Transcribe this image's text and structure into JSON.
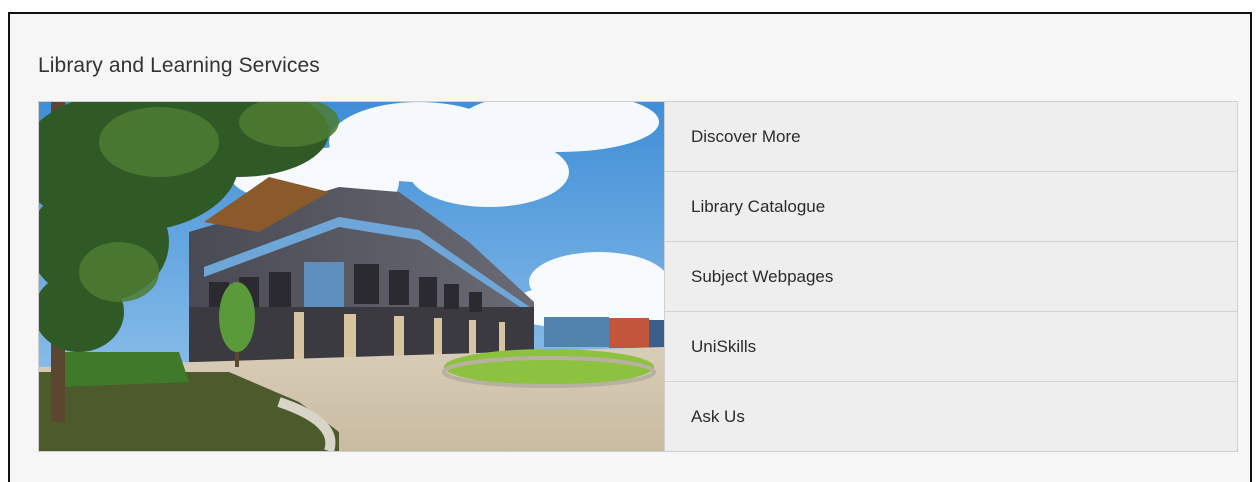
{
  "panel": {
    "title": "Library and Learning Services"
  },
  "hero_image": {
    "alt": "Library building"
  },
  "links": [
    {
      "label": "Discover More"
    },
    {
      "label": "Library Catalogue"
    },
    {
      "label": "Subject Webpages"
    },
    {
      "label": "UniSkills"
    },
    {
      "label": "Ask Us"
    }
  ],
  "colors": {
    "background": "#f6f6f6",
    "link_background": "#eeeeee",
    "border": "#cfcfcf",
    "text": "#333333"
  }
}
